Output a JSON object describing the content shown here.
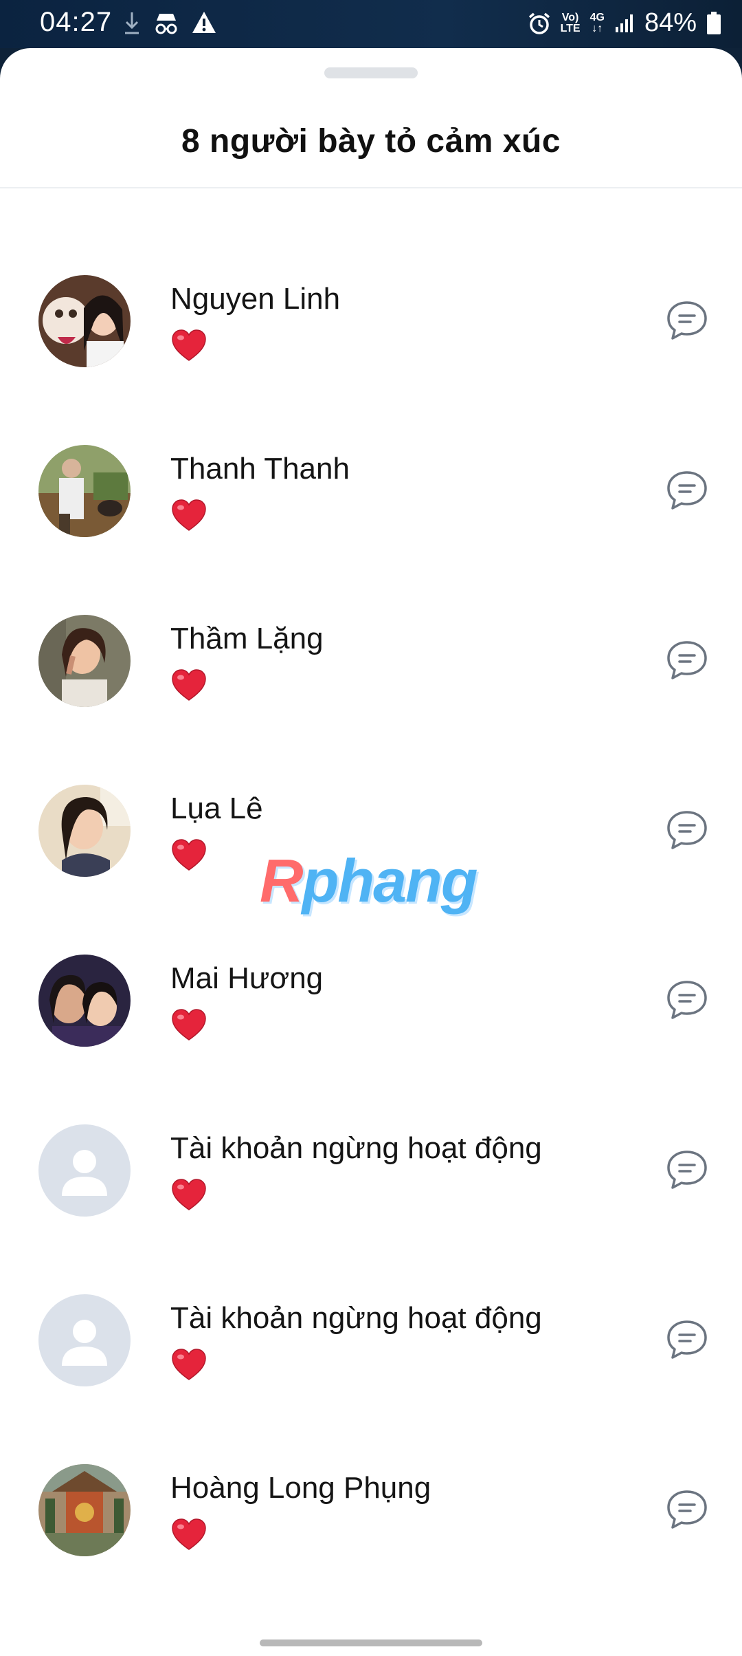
{
  "status_bar": {
    "time": "04:27",
    "battery": "84%",
    "net_top": "Vo)",
    "net_bottom": "LTE",
    "net_4g": "4G"
  },
  "sheet": {
    "title": "8 người bày tỏ cảm xúc"
  },
  "reactors": [
    {
      "name": "Nguyen Linh",
      "reaction": "heart",
      "avatar": "photo"
    },
    {
      "name": "Thanh Thanh",
      "reaction": "heart",
      "avatar": "photo"
    },
    {
      "name": "Thầm Lặng",
      "reaction": "heart",
      "avatar": "photo"
    },
    {
      "name": "Lụa Lê",
      "reaction": "heart",
      "avatar": "photo"
    },
    {
      "name": "Mai Hương",
      "reaction": "heart",
      "avatar": "photo"
    },
    {
      "name": "Tài khoản ngừng hoạt động",
      "reaction": "heart",
      "avatar": "placeholder"
    },
    {
      "name": "Tài khoản ngừng hoạt động",
      "reaction": "heart",
      "avatar": "placeholder"
    },
    {
      "name": "Hoàng Long Phụng",
      "reaction": "heart",
      "avatar": "photo"
    }
  ],
  "watermark": {
    "first": "R",
    "rest": "phang"
  },
  "colors": {
    "heart": "#e5243b",
    "icon": "#6b7480"
  }
}
